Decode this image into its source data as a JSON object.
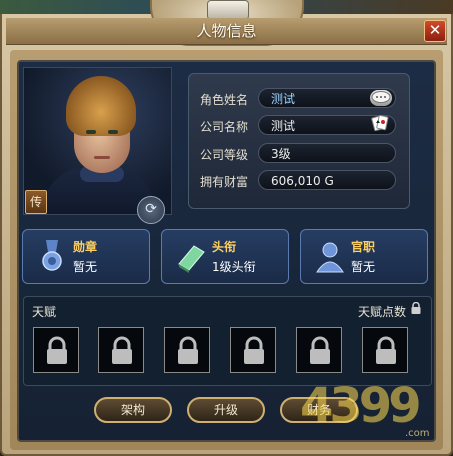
{
  "window": {
    "title": "人物信息",
    "close_glyph": "✕"
  },
  "profile": {
    "bio_button": "传",
    "rotate_glyph": "⟳",
    "fields": [
      {
        "label": "角色姓名",
        "value": "测试"
      },
      {
        "label": "公司名称",
        "value": "测试"
      },
      {
        "label": "公司等级",
        "value": "3级"
      },
      {
        "label": "拥有财富",
        "value": "606,010 G"
      }
    ],
    "name_icon": "chat-bubble-icon",
    "company_icon": "playing-cards-icon"
  },
  "cards": [
    {
      "title": "勋章",
      "value": "暂无",
      "icon": "medal-icon"
    },
    {
      "title": "头衔",
      "value": "1级头衔",
      "icon": "book-icon"
    },
    {
      "title": "官职",
      "value": "暂无",
      "icon": "person-icon"
    }
  ],
  "talent": {
    "label": "天赋",
    "points_label": "天赋点数",
    "slots_locked": 6
  },
  "actions": [
    {
      "label": "架构"
    },
    {
      "label": "升级"
    },
    {
      "label": "财务"
    }
  ],
  "watermark": {
    "text": "4399",
    "suffix": ".com"
  },
  "colors": {
    "card_title": "#ffd060",
    "name_value": "#9ed4ff",
    "panel_bg": "#1c2c44"
  }
}
